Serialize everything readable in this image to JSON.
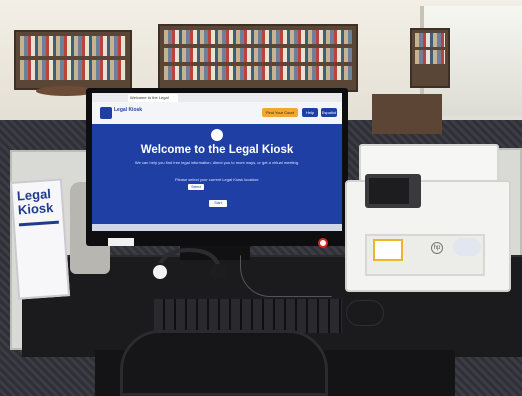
{
  "screen": {
    "tab_title": "Welcome to the Legal Kiosk",
    "site_name": "Legal Kiosk",
    "header_buttons": [
      "Find Your Court",
      "Help",
      "Español"
    ],
    "title": "Welcome to the Legal Kiosk",
    "subtitle": "We can help you find free legal information, direct you to more ways, or get a virtual meeting.",
    "prompt": "Please select your current Legal Kiosk location:",
    "select_label": "Select",
    "start_label": "Start"
  },
  "sign": {
    "label": "Legal Kiosk"
  },
  "printer": {
    "brand": "hp"
  },
  "colors": {
    "screen_blue": "#1f3fa5",
    "header_orange": "#f3a72f",
    "desk": "#1b1b1d"
  },
  "icons": [
    "scale-icon",
    "no-food-icon",
    "hp-logo-icon"
  ]
}
